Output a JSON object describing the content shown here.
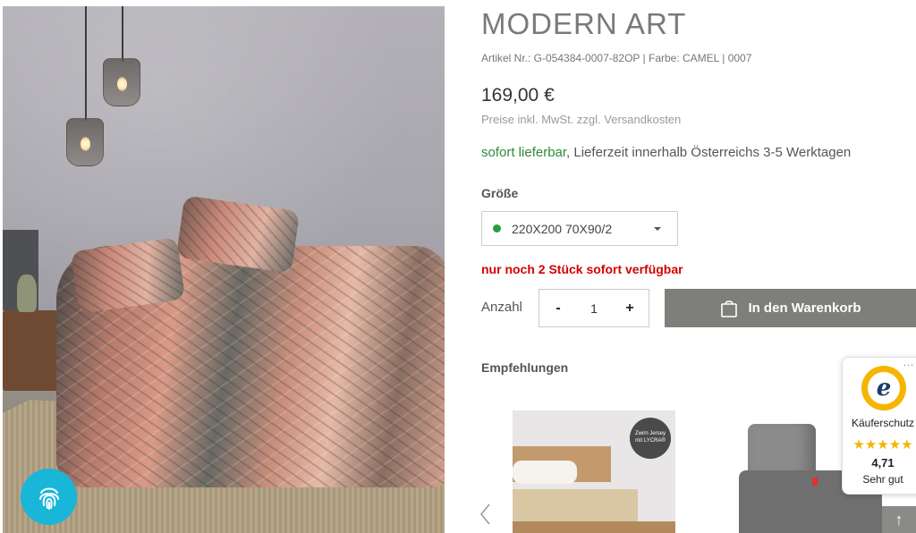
{
  "product": {
    "title": "MODERN ART",
    "article_line": "Artikel Nr.: G-054384-0007-82OP | Farbe: CAMEL | 0007",
    "price": "169,00 €",
    "price_note": "Preise inkl. MwSt. zzgl. Versandkosten",
    "delivery_status": "sofort lieferbar",
    "delivery_text": ", Lieferzeit innerhalb Österreichs 3-5 Werktagen",
    "size_label": "Größe",
    "size_value": "220X200 70X90/2",
    "stock_text": "nur noch 2 Stück sofort verfügbar",
    "qty_label": "Anzahl",
    "qty_minus": "-",
    "qty_value": "1",
    "qty_plus": "+",
    "cart_label": "In den Warenkorb",
    "recommendations_label": "Empfehlungen"
  },
  "recommendations": [
    {
      "badge_line1": "Zwirn Jersey",
      "badge_line2": "mit LYCRA®"
    },
    {
      "badge_line1": "",
      "badge_line2": ""
    }
  ],
  "trusted_shops": {
    "menu": "...",
    "seal_letter": "e",
    "title": "Käuferschutz",
    "stars": "★★★★★",
    "score": "4,71",
    "grade": "Sehr gut"
  },
  "ui": {
    "scroll_top": "↑",
    "status_color_ok": "#2e8b3a",
    "stock_color": "#d40000",
    "cart_button_color": "#7e7e7a",
    "fingerprint_badge_color": "#19b6d8"
  }
}
